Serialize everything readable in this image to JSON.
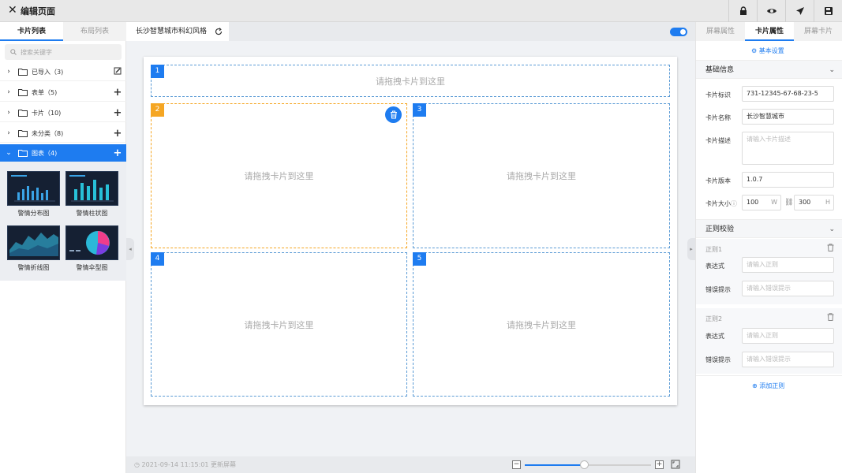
{
  "header": {
    "close_icon": "close-icon",
    "title": "编辑页面",
    "actions": [
      "lock-icon",
      "eye-icon",
      "send-icon",
      "save-icon"
    ]
  },
  "left_panel": {
    "tabs": [
      "卡片列表",
      "布局列表"
    ],
    "search_placeholder": "搜索关键字",
    "tree": [
      {
        "label": "已导入（3)",
        "action": "edit-icon"
      },
      {
        "label": "表单（5)",
        "action": "+"
      },
      {
        "label": "卡片（10)",
        "action": "+"
      },
      {
        "label": "未分类（8)",
        "action": "+"
      },
      {
        "label": "图表（4)",
        "action": "+"
      }
    ],
    "thumbnails": [
      "警情分布图",
      "警情柱状图",
      "警情折线图",
      "警情伞型图"
    ]
  },
  "center": {
    "tab_title": "长沙智慧城市科幻风格",
    "placeholder": "请拖拽卡片到这里",
    "slots": [
      "1",
      "2",
      "3",
      "4",
      "5"
    ],
    "footer_timestamp": "2021-09-14 11:15:01 更新屏幕",
    "zoom_percent": 50
  },
  "right_panel": {
    "tabs": [
      "屏幕属性",
      "卡片属性",
      "屏幕卡片"
    ],
    "basic_settings": "基本设置",
    "section_info": "基础信息",
    "fields": {
      "id_label": "卡片标识",
      "id_value": "731-12345-67-68-23-5",
      "name_label": "卡片名称",
      "name_value": "长沙智慧城市",
      "desc_label": "卡片描述",
      "desc_placeholder": "请输入卡片描述",
      "version_label": "卡片版本",
      "version_value": "1.0.7",
      "size_label": "卡片大小",
      "width_value": "100",
      "width_unit": "W",
      "height_value": "300",
      "height_unit": "H"
    },
    "section_regex": "正则校验",
    "rules": [
      {
        "title": "正则1",
        "expr_label": "表达式",
        "expr_placeholder": "请输入正则",
        "err_label": "错误提示",
        "err_placeholder": "请输入错误提示"
      },
      {
        "title": "正则2",
        "expr_label": "表达式",
        "expr_placeholder": "请输入正则",
        "err_label": "错误提示",
        "err_placeholder": "请输入错误提示"
      }
    ],
    "add_rule": "添加正则"
  }
}
